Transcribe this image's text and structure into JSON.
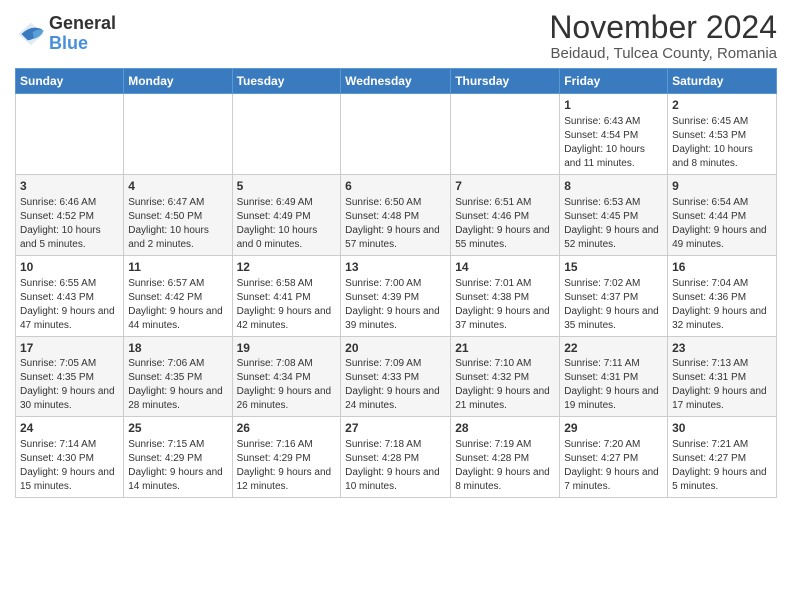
{
  "logo": {
    "line1": "General",
    "line2": "Blue"
  },
  "title": "November 2024",
  "subtitle": "Beidaud, Tulcea County, Romania",
  "days_header": [
    "Sunday",
    "Monday",
    "Tuesday",
    "Wednesday",
    "Thursday",
    "Friday",
    "Saturday"
  ],
  "weeks": [
    [
      {
        "day": "",
        "info": ""
      },
      {
        "day": "",
        "info": ""
      },
      {
        "day": "",
        "info": ""
      },
      {
        "day": "",
        "info": ""
      },
      {
        "day": "",
        "info": ""
      },
      {
        "day": "1",
        "info": "Sunrise: 6:43 AM\nSunset: 4:54 PM\nDaylight: 10 hours and 11 minutes."
      },
      {
        "day": "2",
        "info": "Sunrise: 6:45 AM\nSunset: 4:53 PM\nDaylight: 10 hours and 8 minutes."
      }
    ],
    [
      {
        "day": "3",
        "info": "Sunrise: 6:46 AM\nSunset: 4:52 PM\nDaylight: 10 hours and 5 minutes."
      },
      {
        "day": "4",
        "info": "Sunrise: 6:47 AM\nSunset: 4:50 PM\nDaylight: 10 hours and 2 minutes."
      },
      {
        "day": "5",
        "info": "Sunrise: 6:49 AM\nSunset: 4:49 PM\nDaylight: 10 hours and 0 minutes."
      },
      {
        "day": "6",
        "info": "Sunrise: 6:50 AM\nSunset: 4:48 PM\nDaylight: 9 hours and 57 minutes."
      },
      {
        "day": "7",
        "info": "Sunrise: 6:51 AM\nSunset: 4:46 PM\nDaylight: 9 hours and 55 minutes."
      },
      {
        "day": "8",
        "info": "Sunrise: 6:53 AM\nSunset: 4:45 PM\nDaylight: 9 hours and 52 minutes."
      },
      {
        "day": "9",
        "info": "Sunrise: 6:54 AM\nSunset: 4:44 PM\nDaylight: 9 hours and 49 minutes."
      }
    ],
    [
      {
        "day": "10",
        "info": "Sunrise: 6:55 AM\nSunset: 4:43 PM\nDaylight: 9 hours and 47 minutes."
      },
      {
        "day": "11",
        "info": "Sunrise: 6:57 AM\nSunset: 4:42 PM\nDaylight: 9 hours and 44 minutes."
      },
      {
        "day": "12",
        "info": "Sunrise: 6:58 AM\nSunset: 4:41 PM\nDaylight: 9 hours and 42 minutes."
      },
      {
        "day": "13",
        "info": "Sunrise: 7:00 AM\nSunset: 4:39 PM\nDaylight: 9 hours and 39 minutes."
      },
      {
        "day": "14",
        "info": "Sunrise: 7:01 AM\nSunset: 4:38 PM\nDaylight: 9 hours and 37 minutes."
      },
      {
        "day": "15",
        "info": "Sunrise: 7:02 AM\nSunset: 4:37 PM\nDaylight: 9 hours and 35 minutes."
      },
      {
        "day": "16",
        "info": "Sunrise: 7:04 AM\nSunset: 4:36 PM\nDaylight: 9 hours and 32 minutes."
      }
    ],
    [
      {
        "day": "17",
        "info": "Sunrise: 7:05 AM\nSunset: 4:35 PM\nDaylight: 9 hours and 30 minutes."
      },
      {
        "day": "18",
        "info": "Sunrise: 7:06 AM\nSunset: 4:35 PM\nDaylight: 9 hours and 28 minutes."
      },
      {
        "day": "19",
        "info": "Sunrise: 7:08 AM\nSunset: 4:34 PM\nDaylight: 9 hours and 26 minutes."
      },
      {
        "day": "20",
        "info": "Sunrise: 7:09 AM\nSunset: 4:33 PM\nDaylight: 9 hours and 24 minutes."
      },
      {
        "day": "21",
        "info": "Sunrise: 7:10 AM\nSunset: 4:32 PM\nDaylight: 9 hours and 21 minutes."
      },
      {
        "day": "22",
        "info": "Sunrise: 7:11 AM\nSunset: 4:31 PM\nDaylight: 9 hours and 19 minutes."
      },
      {
        "day": "23",
        "info": "Sunrise: 7:13 AM\nSunset: 4:31 PM\nDaylight: 9 hours and 17 minutes."
      }
    ],
    [
      {
        "day": "24",
        "info": "Sunrise: 7:14 AM\nSunset: 4:30 PM\nDaylight: 9 hours and 15 minutes."
      },
      {
        "day": "25",
        "info": "Sunrise: 7:15 AM\nSunset: 4:29 PM\nDaylight: 9 hours and 14 minutes."
      },
      {
        "day": "26",
        "info": "Sunrise: 7:16 AM\nSunset: 4:29 PM\nDaylight: 9 hours and 12 minutes."
      },
      {
        "day": "27",
        "info": "Sunrise: 7:18 AM\nSunset: 4:28 PM\nDaylight: 9 hours and 10 minutes."
      },
      {
        "day": "28",
        "info": "Sunrise: 7:19 AM\nSunset: 4:28 PM\nDaylight: 9 hours and 8 minutes."
      },
      {
        "day": "29",
        "info": "Sunrise: 7:20 AM\nSunset: 4:27 PM\nDaylight: 9 hours and 7 minutes."
      },
      {
        "day": "30",
        "info": "Sunrise: 7:21 AM\nSunset: 4:27 PM\nDaylight: 9 hours and 5 minutes."
      }
    ]
  ]
}
